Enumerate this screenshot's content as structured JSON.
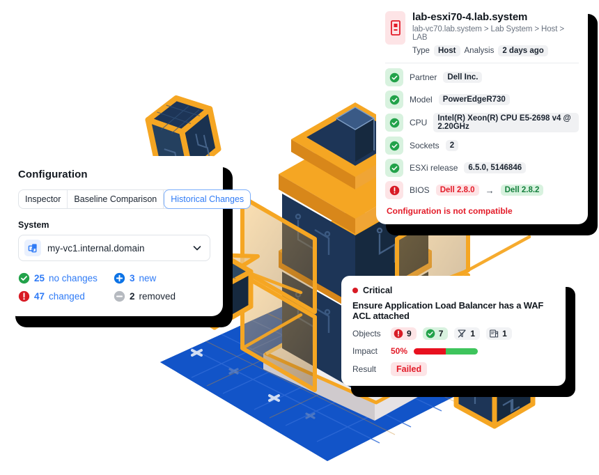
{
  "colors": {
    "accent_orange": "#F5A623",
    "deep_navy": "#1D3557",
    "platform_blue": "#1254C8",
    "brand_blue": "#2F7BF6",
    "danger_red": "#E31B28",
    "success_green": "#22A24A"
  },
  "config_card": {
    "title": "Configuration",
    "tabs": [
      {
        "label": "Inspector",
        "active": false
      },
      {
        "label": "Baseline Comparison",
        "active": false
      },
      {
        "label": "Historical Changes",
        "active": true
      }
    ],
    "system_label": "System",
    "system_select": {
      "value": "my-vc1.internal.domain",
      "icon": "vcenter-icon",
      "chevron": "chevron-down-icon"
    },
    "stats": [
      {
        "icon": "check-circle-icon",
        "count": "25",
        "label": "no changes"
      },
      {
        "icon": "plus-circle-icon",
        "count": "3",
        "label": "new"
      },
      {
        "icon": "exclamation-circle-icon",
        "count": "47",
        "label": "changed"
      },
      {
        "icon": "minus-circle-icon",
        "count": "2",
        "label": "removed"
      }
    ]
  },
  "host_card": {
    "icon": "server-host-icon",
    "title": "lab-esxi70-4.lab.system",
    "breadcrumb": "lab-vc70.lab.system > Lab System > Host > LAB",
    "type_label": "Type",
    "type_value": "Host",
    "analysis_label": "Analysis",
    "analysis_value": "2 days ago",
    "rows": [
      {
        "status": "ok",
        "label": "Partner",
        "value": "Dell Inc."
      },
      {
        "status": "ok",
        "label": "Model",
        "value": "PowerEdgeR730"
      },
      {
        "status": "ok",
        "label": "CPU",
        "value": "Intel(R) Xeon(R) CPU E5-2698 v4 @ 2.20GHz"
      },
      {
        "status": "ok",
        "label": "Sockets",
        "value": "2"
      },
      {
        "status": "ok",
        "label": "ESXi release",
        "value": "6.5.0, 5146846"
      }
    ],
    "bios": {
      "status": "err",
      "label": "BIOS",
      "from": "Dell 2.8.0",
      "arrow": "→",
      "to": "Dell 2.8.2"
    },
    "warning": "Configuration is not compatible"
  },
  "critical_card": {
    "severity": "Critical",
    "title": "Ensure Application Load Balancer has a WAF ACL attached",
    "objects_label": "Objects",
    "objects": [
      {
        "icon": "exclamation-circle-icon",
        "count": "9",
        "tone": "red"
      },
      {
        "icon": "check-circle-icon",
        "count": "7",
        "tone": "grn"
      },
      {
        "icon": "filter-off-icon",
        "count": "1",
        "tone": "gry"
      },
      {
        "icon": "report-icon",
        "count": "1",
        "tone": "gry"
      }
    ],
    "impact_label": "Impact",
    "impact_value": "50%",
    "impact_percent": 50,
    "result_label": "Result",
    "result_value": "Failed"
  }
}
